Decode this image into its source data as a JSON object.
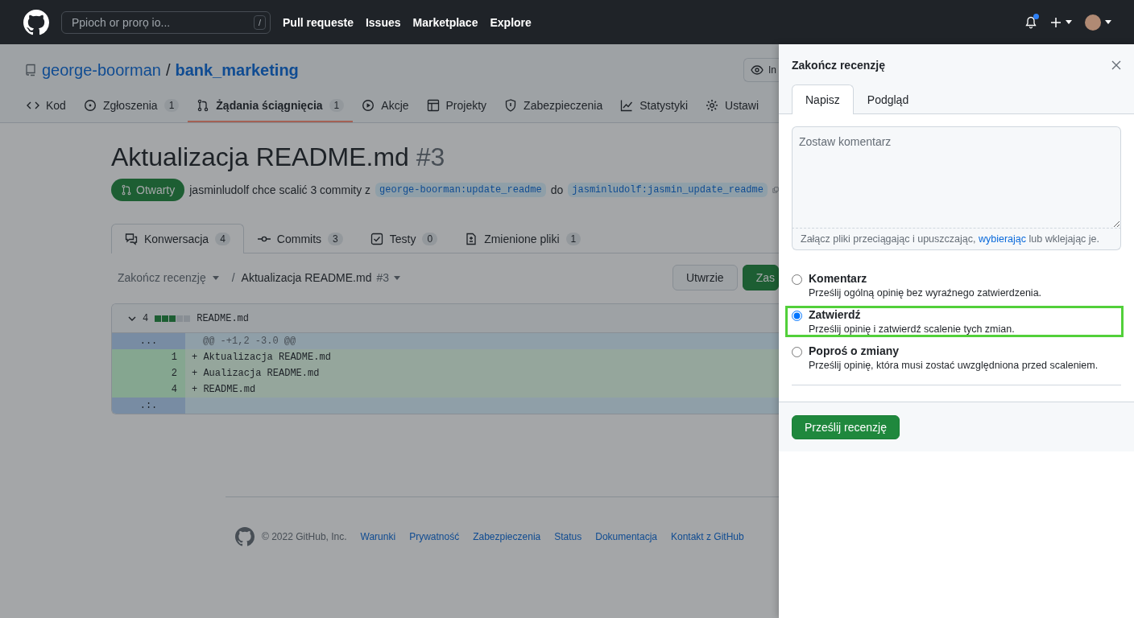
{
  "header": {
    "search": {
      "placeholder": "Ppioch or prorọ io...",
      "shortcut": "/"
    },
    "nav": [
      "Pull requeste",
      "Issues",
      "Marketplace",
      "Explore"
    ],
    "notifications": {
      "unread": true
    }
  },
  "repo": {
    "owner": "george-boorman",
    "separator": "/",
    "name": "bank_marketing",
    "watch_button": "In"
  },
  "repo_tabs": [
    {
      "kind": "code",
      "label": "Kod",
      "selected": false
    },
    {
      "kind": "issue",
      "label": "Zgłoszenia",
      "counter": "1",
      "selected": false
    },
    {
      "kind": "pull",
      "label": "Żądania ściągnięcia",
      "counter": "1",
      "selected": true
    },
    {
      "kind": "play",
      "label": "Akcje",
      "selected": false
    },
    {
      "kind": "table",
      "label": "Projekty",
      "selected": false
    },
    {
      "kind": "shield",
      "label": "Zabezpieczenia",
      "selected": false
    },
    {
      "kind": "graph",
      "label": "Statystyki",
      "selected": false
    },
    {
      "kind": "gear",
      "label": "Ustawi",
      "selected": false
    }
  ],
  "pull_request": {
    "title": "Aktualizacja README.md",
    "number": "#3",
    "state": "Otwarty",
    "summary": "jasminludolf chce scalić 3 commity z",
    "head_branch": "george-boorman:update_readme",
    "joiner": "do",
    "base_branch": "jasminludolf:jasmin_update_readme"
  },
  "pr_tabs": [
    {
      "kind": "conversation",
      "label": "Konwersacja",
      "counter": "4",
      "selected": true
    },
    {
      "kind": "commit",
      "label": "Commits",
      "counter": "3",
      "selected": false
    },
    {
      "kind": "check",
      "label": "Testy",
      "counter": "0",
      "selected": false
    },
    {
      "kind": "file",
      "label": "Zmienione pliki",
      "counter": "1",
      "selected": false
    }
  ],
  "review_toolbar": {
    "review_menu": "Zakończ recenzję",
    "separator": "/",
    "pr_menu": "Aktualizacja README.md",
    "pr_number": "#3",
    "buttons": [
      {
        "kind": "default",
        "label": "Utwrzie"
      },
      {
        "kind": "primary",
        "label": "Zas"
      }
    ]
  },
  "diff": {
    "count": "4",
    "diffstat": [
      {
        "kind": "added"
      },
      {
        "kind": "added"
      },
      {
        "kind": "added"
      },
      {
        "kind": "neutral"
      },
      {
        "kind": "neutral"
      }
    ],
    "file": "README.md",
    "lines": [
      {
        "kind": "hunk",
        "number": "...",
        "text": "@@ -+1,2 -3.0 @@"
      },
      {
        "kind": "added",
        "number": "1",
        "text": "+ Aktualizacja README.md"
      },
      {
        "kind": "added",
        "number": "2",
        "text": "+ Aualizacja README.md"
      },
      {
        "kind": "added",
        "number": "4",
        "text": "+ README.md"
      },
      {
        "kind": "hunk",
        "number": ".:."
      }
    ]
  },
  "footer": {
    "copyright": "© 2022 GitHub, Inc.",
    "links": [
      "Warunki",
      "Prywatność",
      "Zabezpieczenia",
      "Status",
      "Dokumentacja",
      "Kontakt z GitHub"
    ]
  },
  "panel": {
    "title": "Zakończ recenzję",
    "tabs": [
      {
        "label": "Napisz",
        "selected": true
      },
      {
        "label": "Podgląd",
        "selected": false
      }
    ],
    "comment": {
      "placeholder": "Zostaw komentarz"
    },
    "attach_hint": {
      "before": "Załącz pliki przeciągając i upuszczając,",
      "link": "wybierając",
      "after": "lub wklejając je."
    },
    "options": [
      {
        "label": "Komentarz",
        "description": "Prześlij ogólną opinię bez wyraźnego zatwierdzenia.",
        "selected": false,
        "highlighted": false
      },
      {
        "label": "Zatwierdź",
        "description": "Prześlij opinię i zatwierdź scalenie tych zmian.",
        "selected": true,
        "highlighted": true
      },
      {
        "label": "Poproś o zmiany",
        "description": "Prześlij opinię, która musi zostać uwzględniona przed scaleniem.",
        "selected": false,
        "highlighted": false
      }
    ],
    "submit": "Prześlij recenzję"
  }
}
